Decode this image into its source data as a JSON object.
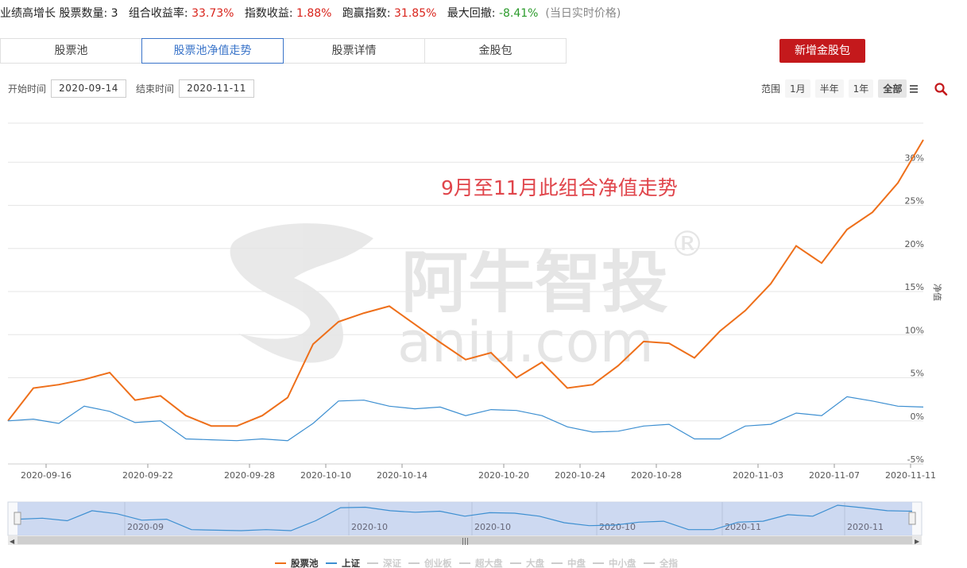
{
  "summary": {
    "name": "业绩高增长",
    "stock_count_label": "股票数量:",
    "stock_count": "3",
    "return_label": "组合收益率:",
    "return_value": "33.73%",
    "index_label": "指数收益:",
    "index_value": "1.88%",
    "beat_label": "跑赢指数:",
    "beat_value": "31.85%",
    "drawdown_label": "最大回撤:",
    "drawdown_value": "-8.41%",
    "price_note": "(当日实时价格)"
  },
  "tabs": [
    "股票池",
    "股票池净值走势",
    "股票详情",
    "金股包"
  ],
  "add_button": "新增金股包",
  "dates": {
    "start_label": "开始时间",
    "start_value": "2020-09-14",
    "end_label": "结束时间",
    "end_value": "2020-11-11"
  },
  "range": {
    "label": "范围",
    "options": [
      "1月",
      "半年",
      "1年",
      "全部"
    ],
    "selected": "全部"
  },
  "watermark": {
    "cn": "阿牛智投",
    "en": "aniu.com",
    "mark": "®"
  },
  "chart_data": {
    "type": "line",
    "annotation": "9月至11月此组合净值走势",
    "ylabel": "净值",
    "ylim": [
      -5,
      35
    ],
    "yticks": [
      "-5%",
      "0%",
      "5%",
      "10%",
      "15%",
      "20%",
      "25%",
      "30%"
    ],
    "ytick_values": [
      -5,
      0,
      5,
      10,
      15,
      20,
      25,
      30
    ],
    "xticks": [
      {
        "label": "2020-09-16",
        "i": 1
      },
      {
        "label": "2020-09-22",
        "i": 5
      },
      {
        "label": "2020-09-28",
        "i": 9
      },
      {
        "label": "2020-10-10",
        "i": 12
      },
      {
        "label": "2020-10-14",
        "i": 15
      },
      {
        "label": "2020-10-20",
        "i": 19
      },
      {
        "label": "2020-10-24",
        "i": 22
      },
      {
        "label": "2020-10-28",
        "i": 25
      },
      {
        "label": "2020-11-03",
        "i": 29
      },
      {
        "label": "2020-11-07",
        "i": 32
      },
      {
        "label": "2020-11-11",
        "i": 35
      }
    ],
    "n_points": 36,
    "series": [
      {
        "name": "股票池",
        "color": "#ee6f1a",
        "values": [
          0,
          3.8,
          4.2,
          4.8,
          5.6,
          2.4,
          2.9,
          0.6,
          -0.6,
          -0.6,
          0.6,
          2.7,
          8.9,
          11.5,
          12.5,
          13.3,
          11.2,
          9.1,
          7.1,
          7.9,
          5.0,
          6.8,
          3.8,
          4.2,
          6.4,
          9.2,
          9.0,
          7.3,
          10.4,
          12.8,
          15.9,
          20.3,
          18.3,
          22.2,
          24.2,
          27.6,
          32.6
        ],
        "legend": true
      },
      {
        "name": "上证",
        "color": "#3d8fd1",
        "values": [
          0,
          0.2,
          -0.3,
          1.7,
          1.1,
          -0.2,
          0,
          -2.1,
          -2.2,
          -2.3,
          -2.1,
          -2.3,
          -0.3,
          2.3,
          2.4,
          1.7,
          1.4,
          1.6,
          0.6,
          1.3,
          1.2,
          0.6,
          -0.7,
          -1.3,
          -1.2,
          -0.6,
          -0.4,
          -2.1,
          -2.1,
          -0.6,
          -0.4,
          0.9,
          0.6,
          2.8,
          2.3,
          1.7,
          1.6
        ],
        "legend": true
      }
    ],
    "legend_items": [
      "股票池",
      "上证",
      "深证",
      "创业板",
      "超大盘",
      "大盘",
      "中盘",
      "中小盘",
      "全指"
    ],
    "legend_active": [
      "股票池",
      "上证"
    ],
    "navigator_labels": [
      "2020-09",
      "2020-10",
      "2020-10",
      "2020-10",
      "2020-11",
      "2020-11"
    ]
  }
}
